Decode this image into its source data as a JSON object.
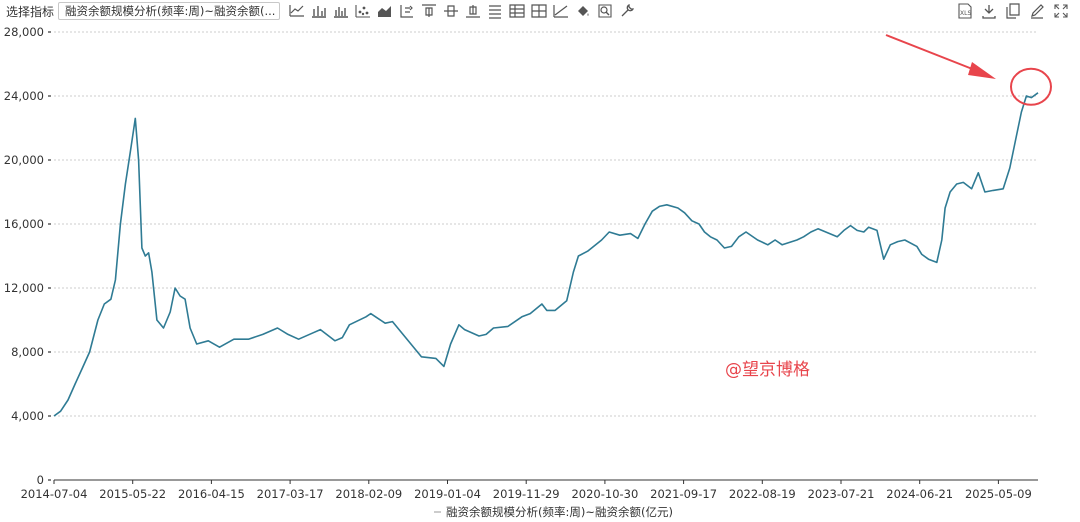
{
  "toolbar": {
    "label": "选择指标",
    "select_value": "融资余额规模分析(频率:周)~融资余额(...",
    "tools": [
      "line-chart-icon",
      "bar-chart-icon",
      "stacked-bar-icon",
      "scatter-icon",
      "area-chart-icon",
      "axis-switch-icon",
      "align-top-icon",
      "align-middle-icon",
      "align-bottom-icon",
      "list-icon",
      "table-icon",
      "crosshair-icon",
      "trend-icon",
      "fill-bucket-icon",
      "zoom-icon",
      "wrench-icon"
    ],
    "right_tools": [
      "export-excel-icon",
      "download-icon",
      "copy-icon",
      "edit-icon",
      "fullscreen-icon"
    ]
  },
  "watermark": "@望京博格",
  "colors": {
    "series": "#2f7b94",
    "grid": "#cccccc",
    "annotation": "#e8454c",
    "axis": "#666666"
  },
  "chart_data": {
    "type": "line",
    "title": "",
    "xlabel": "",
    "ylabel": "",
    "ylim": [
      0,
      28000
    ],
    "yticks": [
      0,
      4000,
      8000,
      12000,
      16000,
      20000,
      24000,
      28000
    ],
    "ytick_labels": [
      "0",
      "4,000",
      "8,000",
      "12,000",
      "16,000",
      "20,000",
      "24,000",
      "28,000"
    ],
    "xlim": [
      "2014-07-04",
      "2025-11-14"
    ],
    "xtick_labels": [
      "2014-07-04",
      "2015-05-22",
      "2016-04-15",
      "2017-03-17",
      "2018-02-09",
      "2019-01-04",
      "2019-11-29",
      "2020-10-30",
      "2021-09-17",
      "2022-08-19",
      "2023-07-21",
      "2024-06-21",
      "2025-05-09"
    ],
    "grid": true,
    "legend": {
      "position": "bottom-center",
      "entries": [
        "融资余额规模分析(频率:周)~融资余额(亿元)"
      ]
    },
    "series": [
      {
        "name": "融资余额规模分析(频率:周)~融资余额(亿元)",
        "points": [
          [
            "2014-07-04",
            4000
          ],
          [
            "2014-08-01",
            4300
          ],
          [
            "2014-09-01",
            5000
          ],
          [
            "2014-10-01",
            6000
          ],
          [
            "2014-11-01",
            7000
          ],
          [
            "2014-12-01",
            8000
          ],
          [
            "2015-01-05",
            10000
          ],
          [
            "2015-02-01",
            11000
          ],
          [
            "2015-03-01",
            11300
          ],
          [
            "2015-03-20",
            12500
          ],
          [
            "2015-04-10",
            16000
          ],
          [
            "2015-05-01",
            18500
          ],
          [
            "2015-05-22",
            20500
          ],
          [
            "2015-06-12",
            22600
          ],
          [
            "2015-06-26",
            20000
          ],
          [
            "2015-07-10",
            14500
          ],
          [
            "2015-07-24",
            14000
          ],
          [
            "2015-08-07",
            14200
          ],
          [
            "2015-08-21",
            13000
          ],
          [
            "2015-09-11",
            10000
          ],
          [
            "2015-10-09",
            9500
          ],
          [
            "2015-11-06",
            10500
          ],
          [
            "2015-11-27",
            12000
          ],
          [
            "2015-12-18",
            11500
          ],
          [
            "2016-01-08",
            11300
          ],
          [
            "2016-01-29",
            9500
          ],
          [
            "2016-02-26",
            8500
          ],
          [
            "2016-04-15",
            8700
          ],
          [
            "2016-06-01",
            8300
          ],
          [
            "2016-08-01",
            8800
          ],
          [
            "2016-10-01",
            8800
          ],
          [
            "2016-12-01",
            9100
          ],
          [
            "2017-02-01",
            9500
          ],
          [
            "2017-03-17",
            9100
          ],
          [
            "2017-05-01",
            8800
          ],
          [
            "2017-07-01",
            9200
          ],
          [
            "2017-08-01",
            9400
          ],
          [
            "2017-10-01",
            8700
          ],
          [
            "2017-11-01",
            8900
          ],
          [
            "2017-12-01",
            9700
          ],
          [
            "2018-02-09",
            10200
          ],
          [
            "2018-03-01",
            10400
          ],
          [
            "2018-04-01",
            10100
          ],
          [
            "2018-05-01",
            9800
          ],
          [
            "2018-06-01",
            9900
          ],
          [
            "2018-08-01",
            8800
          ],
          [
            "2018-10-01",
            7700
          ],
          [
            "2018-12-01",
            7600
          ],
          [
            "2019-01-04",
            7100
          ],
          [
            "2019-02-01",
            8500
          ],
          [
            "2019-03-08",
            9700
          ],
          [
            "2019-04-01",
            9400
          ],
          [
            "2019-06-01",
            9000
          ],
          [
            "2019-07-01",
            9100
          ],
          [
            "2019-08-01",
            9500
          ],
          [
            "2019-10-01",
            9600
          ],
          [
            "2019-11-29",
            10200
          ],
          [
            "2020-01-03",
            10400
          ],
          [
            "2020-02-21",
            11000
          ],
          [
            "2020-03-13",
            10600
          ],
          [
            "2020-04-17",
            10600
          ],
          [
            "2020-06-05",
            11200
          ],
          [
            "2020-07-03",
            13000
          ],
          [
            "2020-07-24",
            14000
          ],
          [
            "2020-09-01",
            14300
          ],
          [
            "2020-10-30",
            15000
          ],
          [
            "2020-12-01",
            15500
          ],
          [
            "2021-01-15",
            15300
          ],
          [
            "2021-03-01",
            15400
          ],
          [
            "2021-04-01",
            15100
          ],
          [
            "2021-05-01",
            16000
          ],
          [
            "2021-06-01",
            16800
          ],
          [
            "2021-07-01",
            17100
          ],
          [
            "2021-08-01",
            17200
          ],
          [
            "2021-09-17",
            17000
          ],
          [
            "2021-10-15",
            16700
          ],
          [
            "2021-11-15",
            16200
          ],
          [
            "2021-12-15",
            16000
          ],
          [
            "2022-01-07",
            15500
          ],
          [
            "2022-02-01",
            15200
          ],
          [
            "2022-03-01",
            15000
          ],
          [
            "2022-04-01",
            14500
          ],
          [
            "2022-05-01",
            14600
          ],
          [
            "2022-06-01",
            15200
          ],
          [
            "2022-07-01",
            15500
          ],
          [
            "2022-08-19",
            15000
          ],
          [
            "2022-10-01",
            14700
          ],
          [
            "2022-11-01",
            15000
          ],
          [
            "2022-12-01",
            14700
          ],
          [
            "2023-02-01",
            15000
          ],
          [
            "2023-03-01",
            15200
          ],
          [
            "2023-04-01",
            15500
          ],
          [
            "2023-05-01",
            15700
          ],
          [
            "2023-07-21",
            15200
          ],
          [
            "2023-08-18",
            15600
          ],
          [
            "2023-09-15",
            15900
          ],
          [
            "2023-10-13",
            15600
          ],
          [
            "2023-11-10",
            15500
          ],
          [
            "2023-12-01",
            15800
          ],
          [
            "2024-01-05",
            15600
          ],
          [
            "2024-02-02",
            13800
          ],
          [
            "2024-03-01",
            14700
          ],
          [
            "2024-04-01",
            14900
          ],
          [
            "2024-05-01",
            15000
          ],
          [
            "2024-06-21",
            14600
          ],
          [
            "2024-07-12",
            14100
          ],
          [
            "2024-08-09",
            13800
          ],
          [
            "2024-09-13",
            13600
          ],
          [
            "2024-10-04",
            15000
          ],
          [
            "2024-10-18",
            17000
          ],
          [
            "2024-11-08",
            18000
          ],
          [
            "2024-12-06",
            18500
          ],
          [
            "2025-01-03",
            18600
          ],
          [
            "2025-02-07",
            18200
          ],
          [
            "2025-03-07",
            19200
          ],
          [
            "2025-04-04",
            18000
          ],
          [
            "2025-05-09",
            18100
          ],
          [
            "2025-06-20",
            18200
          ],
          [
            "2025-07-18",
            19500
          ],
          [
            "2025-08-15",
            21500
          ],
          [
            "2025-09-05",
            23000
          ],
          [
            "2025-09-26",
            24000
          ],
          [
            "2025-10-17",
            23900
          ],
          [
            "2025-11-14",
            24200
          ]
        ]
      }
    ]
  }
}
